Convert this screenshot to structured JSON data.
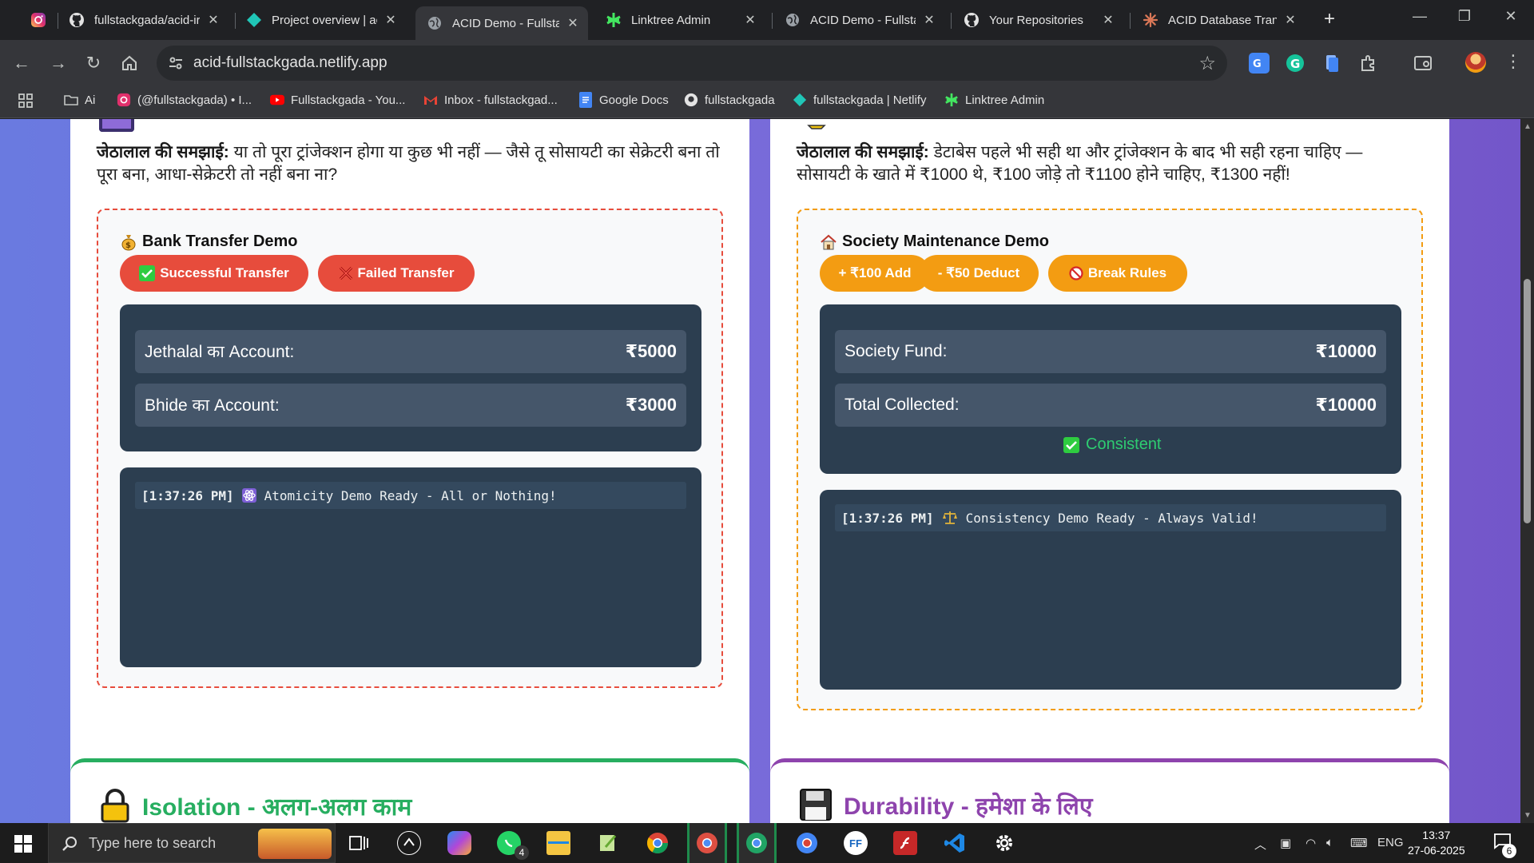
{
  "browser": {
    "tabs": [
      {
        "title": "",
        "icon": "instagram-icon"
      },
      {
        "title": "fullstackgada/acid-ir",
        "icon": "github-icon"
      },
      {
        "title": "Project overview | ac",
        "icon": "netlify-icon"
      },
      {
        "title": "ACID Demo - Fullsta",
        "icon": "globe-icon",
        "active": true
      },
      {
        "title": "Linktree Admin",
        "icon": "linktree-icon"
      },
      {
        "title": "ACID Demo - Fullsta",
        "icon": "globe-icon"
      },
      {
        "title": "Your Repositories",
        "icon": "github-icon"
      },
      {
        "title": "ACID Database Trans",
        "icon": "claude-icon"
      }
    ],
    "url": "acid-fullstackgada.netlify.app",
    "bookmarks": [
      {
        "label": "Ai",
        "icon": "folder-icon"
      },
      {
        "label": "(@fullstackgada) • I...",
        "icon": "instagram-icon"
      },
      {
        "label": "Fullstackgada - You...",
        "icon": "youtube-icon"
      },
      {
        "label": "Inbox - fullstackgad...",
        "icon": "gmail-icon"
      },
      {
        "label": "Google Docs",
        "icon": "docs-icon"
      },
      {
        "label": "fullstackgada",
        "icon": "github-icon"
      },
      {
        "label": "fullstackgada | Netlify",
        "icon": "netlify-icon"
      },
      {
        "label": "Linktree Admin",
        "icon": "linktree-icon"
      }
    ]
  },
  "atomicity": {
    "explain_label": "जेठालाल की समझाई:",
    "explain_text": "या तो पूरा ट्रांजेक्शन होगा या कुछ भी नहीं — जैसे तू सोसायटी का सेक्रेटरी बना तो पूरा बना, आधा-सेक्रेटरी तो नहीं बना ना?",
    "demo_title": "Bank Transfer Demo",
    "buttons": {
      "success": "Successful Transfer",
      "failed": "Failed Transfer"
    },
    "accounts": [
      {
        "label": "Jethalal का Account:",
        "value": "₹5000"
      },
      {
        "label": "Bhide का Account:",
        "value": "₹3000"
      }
    ],
    "log": {
      "time": "[1:37:26 PM]",
      "message": "Atomicity Demo Ready - All or Nothing!"
    },
    "colors": {
      "border": "#e74c3c",
      "button": "#e74c3c"
    }
  },
  "consistency": {
    "explain_label": "जेठालाल की समझाई:",
    "explain_text": "डेटाबेस पहले भी सही था और ट्रांजेक्शन के बाद भी सही रहना चाहिए — सोसायटी के खाते में ₹1000 थे, ₹100 जोड़े तो ₹1100 होने चाहिए, ₹1300 नहीं!",
    "demo_title": "Society Maintenance Demo",
    "buttons": {
      "add": "+ ₹100 Add",
      "deduct": "- ₹50 Deduct",
      "break": "Break Rules"
    },
    "funds": [
      {
        "label": "Society Fund:",
        "value": "₹10000"
      },
      {
        "label": "Total Collected:",
        "value": "₹10000"
      }
    ],
    "status": "Consistent",
    "log": {
      "time": "[1:37:26 PM]",
      "message": "Consistency Demo Ready - Always Valid!"
    },
    "colors": {
      "border": "#f39c12",
      "button": "#f39c12"
    }
  },
  "sections": {
    "isolation": {
      "title": "Isolation - अलग-अलग काम",
      "color": "#27ae60"
    },
    "durability": {
      "title": "Durability - हमेशा के लिए",
      "color": "#8e44ad"
    }
  },
  "taskbar": {
    "search_placeholder": "Type here to search",
    "whatsapp_badge": "4",
    "language": "ENG",
    "time": "13:37",
    "date": "27-06-2025",
    "notifications": "6"
  }
}
